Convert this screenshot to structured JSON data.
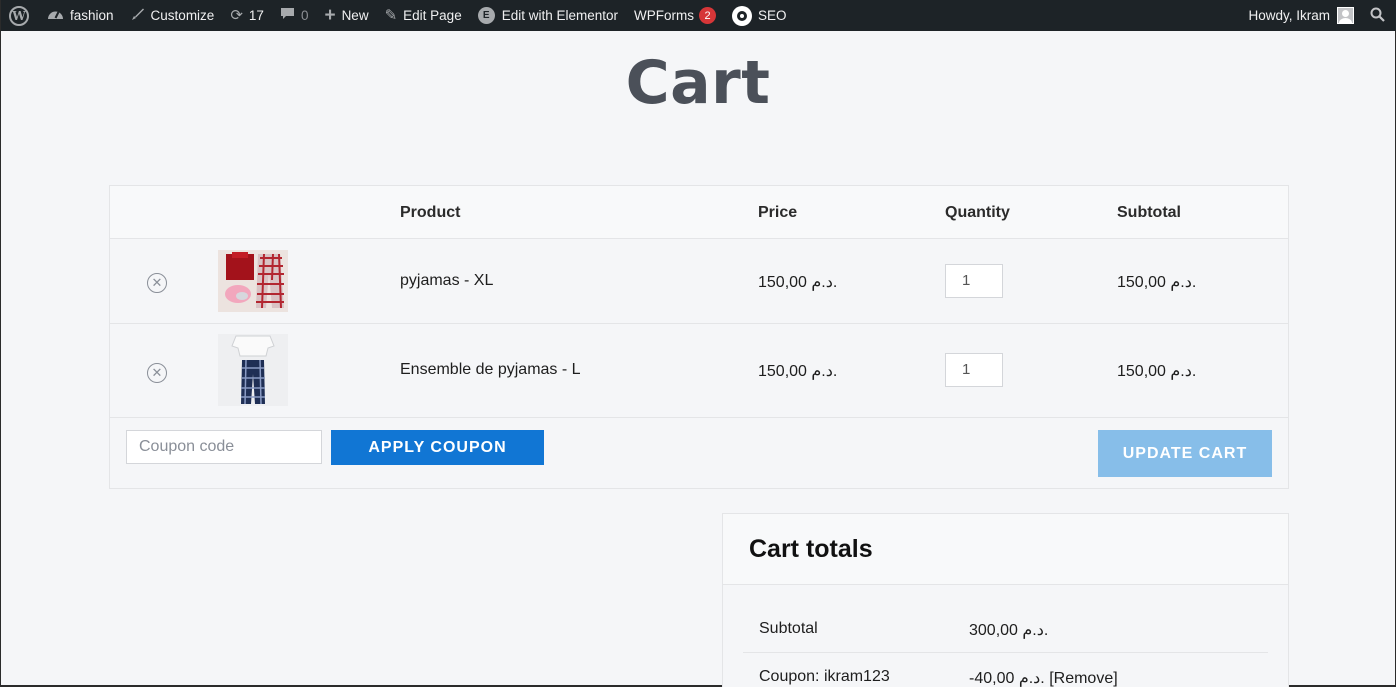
{
  "admin_bar": {
    "site_name": "fashion",
    "customize": "Customize",
    "updates_count": "17",
    "comments_count": "0",
    "new_label": "New",
    "edit_page": "Edit Page",
    "edit_elementor": "Edit with Elementor",
    "wpforms": "WPForms",
    "wpforms_badge": "2",
    "seo": "SEO",
    "howdy": "Howdy, Ikram"
  },
  "page": {
    "title": "Cart"
  },
  "cart": {
    "headers": {
      "product": "Product",
      "price": "Price",
      "quantity": "Quantity",
      "subtotal": "Subtotal"
    },
    "items": [
      {
        "name": "pyjamas - XL",
        "price": "150,00 د.م.",
        "quantity": "1",
        "subtotal": "150,00 د.م."
      },
      {
        "name": "Ensemble de pyjamas - L",
        "price": "150,00 د.م.",
        "quantity": "1",
        "subtotal": "150,00 د.م."
      }
    ],
    "coupon_placeholder": "Coupon code",
    "apply_coupon": "APPLY COUPON",
    "update_cart": "UPDATE CART"
  },
  "totals": {
    "title": "Cart totals",
    "subtotal_label": "Subtotal",
    "subtotal_value": "300,00 د.م.",
    "coupon_label": "Coupon: ikram123",
    "coupon_value": "-40,00 د.م.",
    "coupon_remove": "[Remove]"
  },
  "colors": {
    "admin_bar": "#1d2327",
    "primary_button": "#1176d4",
    "update_button": "#87bee9",
    "badge": "#d63638"
  }
}
